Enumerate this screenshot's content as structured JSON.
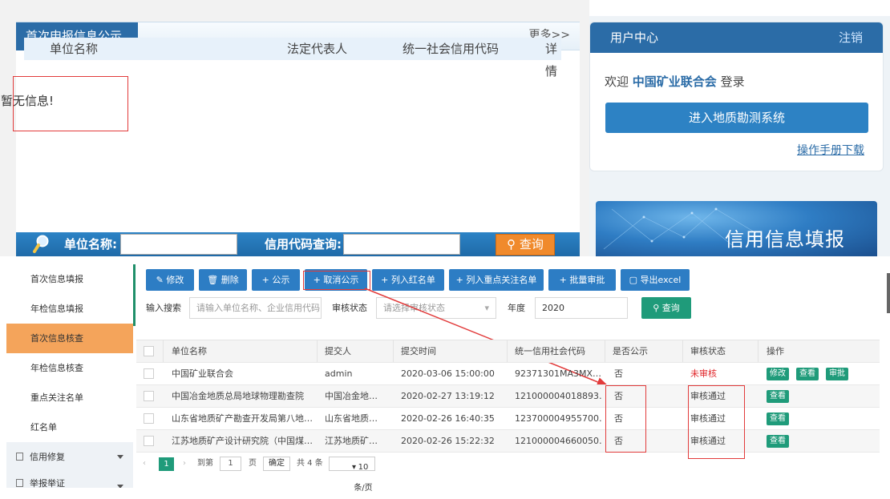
{
  "publicity": {
    "title": "首次申报信息公示",
    "more": "更多>>",
    "columns": [
      "单位名称",
      "法定代表人",
      "统一社会信用代码",
      "详情"
    ],
    "empty_text": "暂无信息!"
  },
  "search": {
    "unit_label": "单位名称:",
    "credit_label": "信用代码查询:",
    "button": "查询"
  },
  "user_center": {
    "title": "用户中心",
    "logout": "注销",
    "welcome_prefix": "欢迎",
    "org": "中国矿业联合会",
    "welcome_suffix": "登录",
    "enter_button": "进入地质勘测系统",
    "manual_link": "操作手册下载"
  },
  "banner": {
    "text": "信用信息填报"
  },
  "sidebar": {
    "items": [
      {
        "label": "首次信息填报",
        "active": false
      },
      {
        "label": "年检信息填报",
        "active": false
      },
      {
        "label": "首次信息核查",
        "active": true
      },
      {
        "label": "年检信息核查",
        "active": false
      },
      {
        "label": "重点关注名单",
        "active": false
      },
      {
        "label": "红名单",
        "active": false
      }
    ],
    "groups": [
      {
        "label": "信用修复"
      },
      {
        "label": "举报举证"
      }
    ]
  },
  "toolbar": {
    "buttons": [
      "✎ 修改",
      "🗑 删除",
      "+ 公示",
      "+ 取消公示",
      "+ 列入红名单",
      "+ 列入重点关注名单",
      "+ 批量审批",
      "▢ 导出excel"
    ]
  },
  "filters": {
    "search_label": "输入搜索",
    "search_placeholder": "请输入单位名称、企业信用代码",
    "status_label": "审核状态",
    "status_placeholder": "请选择审核状态",
    "year_label": "年度",
    "year_value": "2020",
    "query_button": "查询"
  },
  "table": {
    "headers": [
      "单位名称",
      "提交人",
      "提交时间",
      "统一信用社会代码",
      "是否公示",
      "审核状态",
      "操作"
    ],
    "rows": [
      {
        "name": "中国矿业联合会",
        "submitter": "admin",
        "time": "2020-03-06 15:00:00",
        "code": "92371301MA3MX…",
        "public": "否",
        "status": "未审核",
        "ops": [
          "修改",
          "查看",
          "审批"
        ]
      },
      {
        "name": "中国冶金地质总局地球物理勘查院",
        "submitter": "中国冶金地…",
        "time": "2020-02-27 13:19:12",
        "code": "121000004018893…",
        "public": "否",
        "status": "审核通过",
        "ops": [
          "查看"
        ]
      },
      {
        "name": "山东省地质矿产勘查开发局第八地…",
        "submitter": "山东省地质…",
        "time": "2020-02-26 16:40:35",
        "code": "123700004955700…",
        "public": "否",
        "status": "审核通过",
        "ops": [
          "查看"
        ]
      },
      {
        "name": "江苏地质矿产设计研究院（中国煤…",
        "submitter": "江苏地质矿…",
        "time": "2020-02-26 15:22:32",
        "code": "121000004660050…",
        "public": "否",
        "status": "审核通过",
        "ops": [
          "查看"
        ]
      }
    ]
  },
  "pager": {
    "current": "1",
    "goto_label": "到第",
    "goto_value": "1",
    "page_label": "页",
    "confirm": "确定",
    "total": "共 4 条",
    "size": "10 条/页"
  },
  "colors": {
    "primary": "#2b6ca7",
    "button_blue": "#2d7dc4",
    "green": "#1f9b7a",
    "active_nav": "#f4a45b",
    "annotation_red": "#e23b3b"
  }
}
